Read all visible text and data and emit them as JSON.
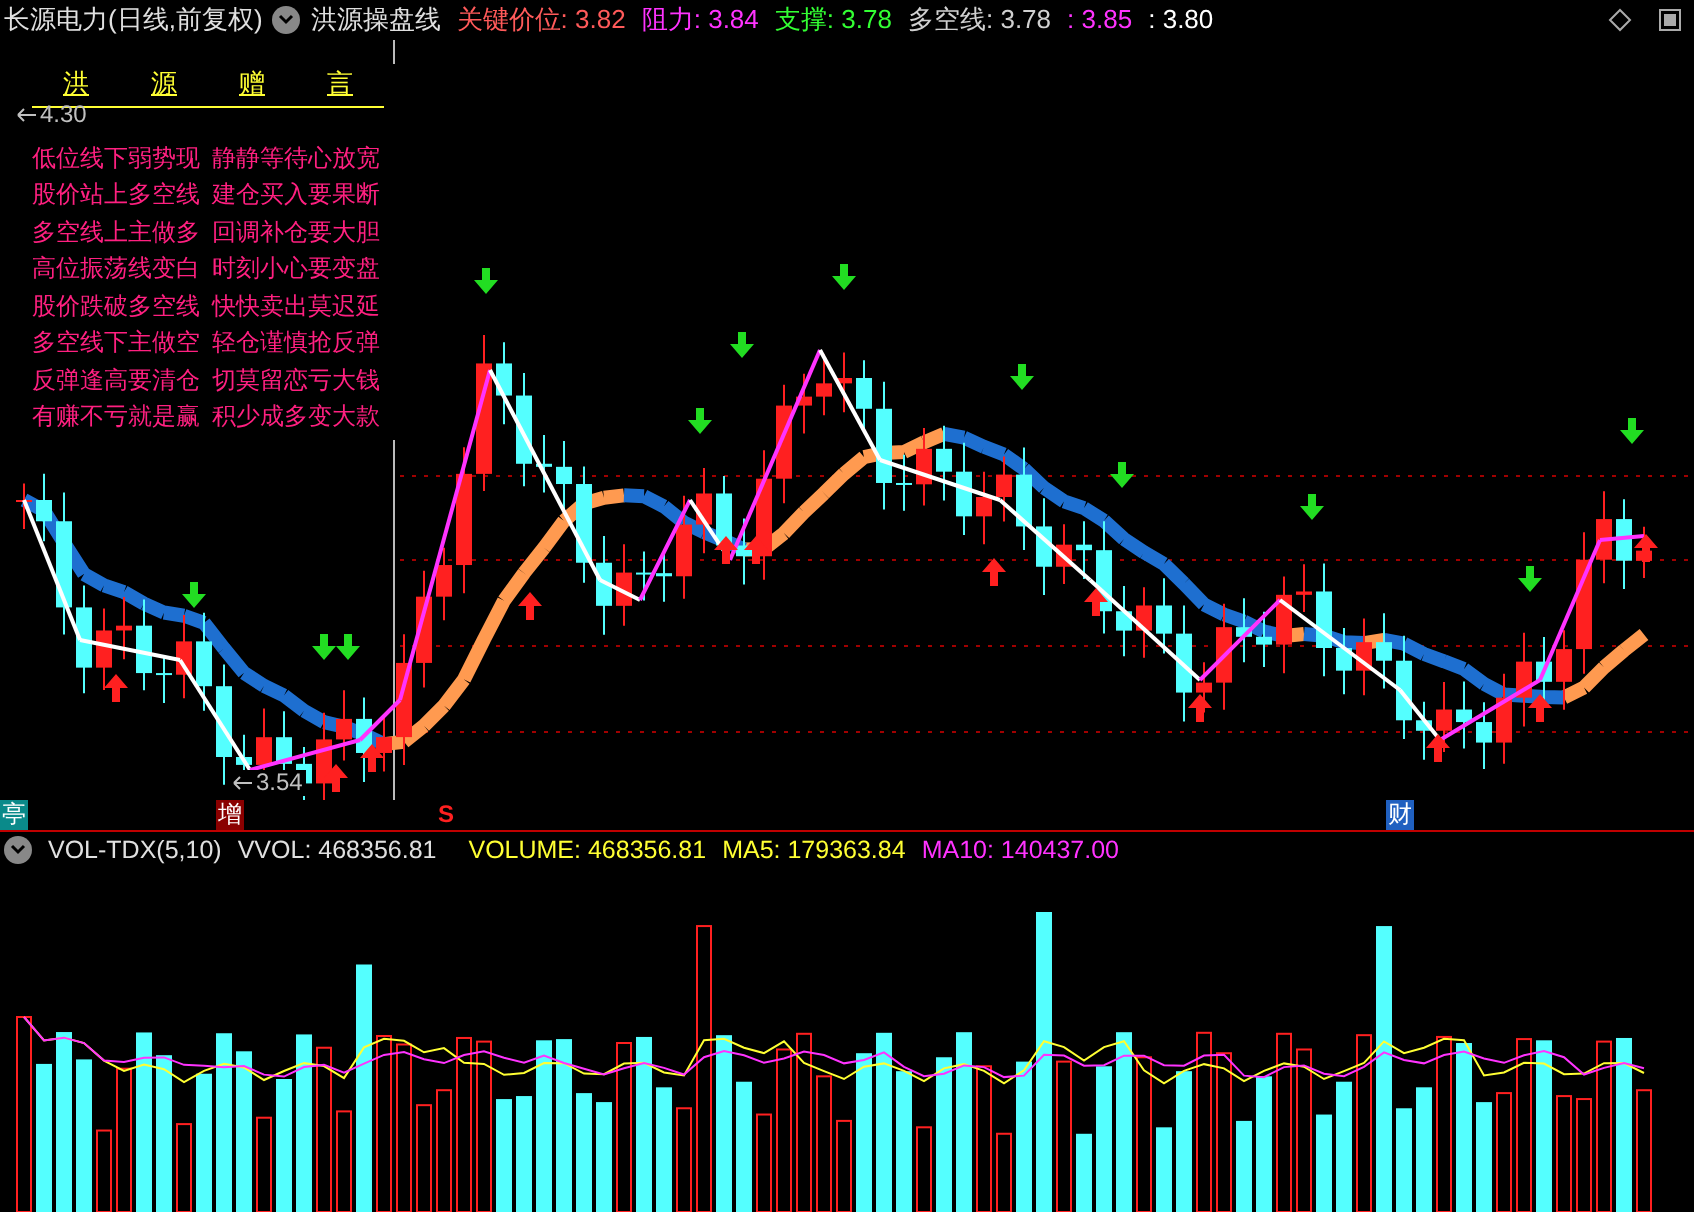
{
  "header": {
    "stock": "长源电力(日线,前复权)",
    "indicator": "洪源操盘线",
    "readings": [
      {
        "label": "关键价位:",
        "value": "3.82",
        "color": "#ff5a5a"
      },
      {
        "label": "阻力:",
        "value": "3.84",
        "color": "#ff33ff"
      },
      {
        "label": "支撑:",
        "value": "3.78",
        "color": "#33ff33"
      },
      {
        "label": "多空线:",
        "value": "3.78",
        "color": "#d0d0d0"
      },
      {
        "label": ":",
        "value": "3.85",
        "color": "#ff33ff"
      },
      {
        "label": ":",
        "value": "3.80",
        "color": "#ffffff"
      }
    ]
  },
  "motto": {
    "title": [
      "洪",
      "源",
      "赠",
      "言"
    ],
    "lines": [
      [
        "低位线下弱势现",
        "静静等待心放宽"
      ],
      [
        "股价站上多空线",
        "建仓买入要果断"
      ],
      [
        "多空线上主做多",
        "回调补仓要大胆"
      ],
      [
        "高位振荡线变白",
        "时刻小心要变盘"
      ],
      [
        "股价跌破多空线",
        "快快卖出莫迟延"
      ],
      [
        "多空线下主做空",
        "轻仓谨慎抢反弹"
      ],
      [
        "反弹逢高要清仓",
        "切莫留恋亏大钱"
      ],
      [
        "有赚不亏就是赢",
        "积少成多变大款"
      ]
    ]
  },
  "price_labels": [
    {
      "kind": "high",
      "text": "4.30"
    },
    {
      "kind": "low",
      "text": "3.54"
    }
  ],
  "markers": [
    {
      "kind": "info",
      "text": "亭"
    },
    {
      "kind": "add",
      "text": "增"
    },
    {
      "kind": "sell",
      "text": "S"
    },
    {
      "kind": "finance",
      "text": "财"
    }
  ],
  "volume_header": {
    "name": "VOL-TDX(5,10)",
    "readings": [
      {
        "text": "VVOL: 468356.81",
        "color": "#e0e0e0"
      },
      {
        "text": "VOLUME: 468356.81",
        "color": "#ffff33"
      },
      {
        "text": "MA5: 179363.84",
        "color": "#ffff33"
      },
      {
        "text": "MA10: 140437.00",
        "color": "#ff33ff"
      }
    ]
  }
}
